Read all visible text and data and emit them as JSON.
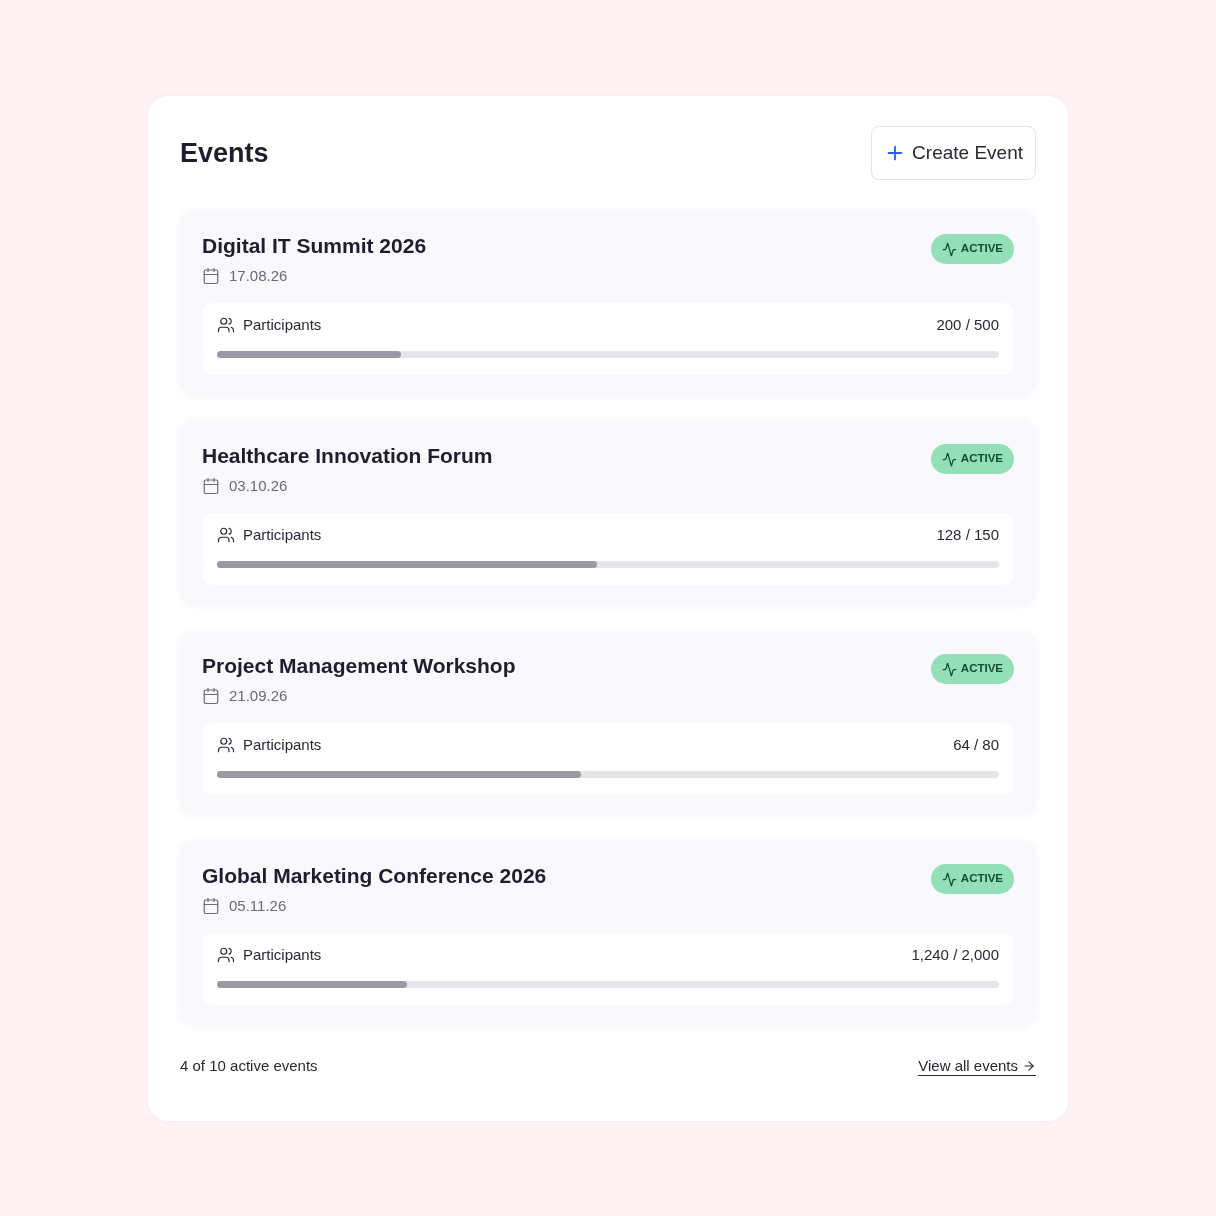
{
  "header": {
    "title": "Events",
    "create_button": "Create Event"
  },
  "events": [
    {
      "title": "Digital IT Summit 2026",
      "date": "17.08.26",
      "status": "ACTIVE",
      "participants_label": "Participants",
      "count": "200 / 500",
      "level": 0.235
    },
    {
      "title": "Healthcare Innovation Forum",
      "date": "03.10.26",
      "status": "ACTIVE",
      "participants_label": "Participants",
      "count": "128 / 150",
      "level": 0.486
    },
    {
      "title": "Project Management Workshop",
      "date": "21.09.26",
      "status": "ACTIVE",
      "participants_label": "Participants",
      "count": "64 / 80",
      "level": 0.465
    },
    {
      "title": "Global Marketing Conference 2026",
      "date": "05.11.26",
      "status": "ACTIVE",
      "participants_label": "Participants",
      "count": "1,240 / 2,000",
      "level": 0.243
    }
  ],
  "footer": {
    "summary": "4 of 10 active events",
    "link": "View all events"
  }
}
